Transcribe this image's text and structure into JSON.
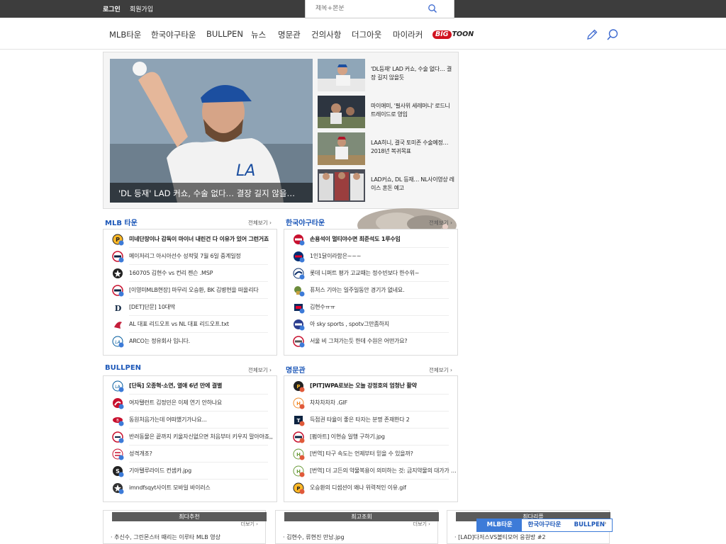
{
  "topbar": {
    "login": "로그인",
    "signup": "회원가입"
  },
  "search": {
    "placeholder": "제목+본문"
  },
  "nav": {
    "items": [
      "MLB타운",
      "한국야구타운",
      "BULLPEN",
      "뉴스",
      "명문관",
      "건의사항",
      "더그아웃",
      "마이라커"
    ],
    "bigtoon": {
      "big": "BIG",
      "toon": "TOON"
    }
  },
  "hero": {
    "caption": "'DL 등재' LAD 커쇼, 수술 없다… 결장 길지 않을…",
    "thumbs": [
      "'DL등재' LAD 커쇼, 수술 없다… 결장 길지 않을듯",
      "마이애미, '필사위 세레머니' 로드니 트레이드로 영입",
      "LAA히니, 결국 토미존 수술예정… 2018년 복귀목표",
      "LAD커쇼, DL 등재… NL사이영상 레이스 혼돈 예고"
    ]
  },
  "sections": {
    "mlb": {
      "title": "MLB 타운",
      "more": "전체보기 ›",
      "items": [
        "미네단장이나 감독이 마이너 내린건 다 이유가 있어 그런거죠",
        "메이저리그 아시아선수 성적및 7월 6일 중계일정",
        "160705 김현수 vs 컨리 젠슨 .MSP",
        "[이영미MLB현장] 마무리 오승환, BK 김병현을 떠올리다",
        "[DET]단문] 10대딱",
        "AL 대표 리드오프 vs NL 대표 리드오프.txt",
        "ARCO는 정유회사 입니다."
      ]
    },
    "korea": {
      "title": "한국야구타운",
      "more": "전체보기 ›",
      "items": [
        "손용석이 멀티야수면 최준석도 1루수임",
        "1인1닭이라함은~~~",
        "롯데 니퍼트 평가 고교때는 정수빈보다 한수위~",
        "퓨처스 기아는 일주일동안 경기가 없네요.",
        "김현수ㅠㅠ",
        "아 sky sports , spotv그만좀하지",
        "서울 비 그쳐가는듯 한데 수원은 어떤가요?"
      ]
    },
    "bullpen": {
      "title": "BULLPEN",
      "more": "전체보기 ›",
      "items": [
        "[단독] 오종혁·소연, 열애 6년 만에 결별",
        "여자탤런트 김정민은 이제 연기 안하나요",
        "동원처음가는데 어떠했기가나요...",
        "반려동물은 끝까지 키울자신없으면 처음부터 키우지 말아야죠,,",
        "성격개조?",
        "기아텔루라이드 컨셉카.jpg",
        "imndfsqyt사이트 모바일 바이러스"
      ]
    },
    "hall": {
      "title": "명문관",
      "more": "전체보기 ›",
      "items": [
        "[PIT]WPA로보는 오늘 강정호의 엄청난 활약",
        "차차차차차 .GIF",
        "득점권 타율이 좋은 타자는 분명 존재한다 2",
        "[펌아트] 이현승 일행 구하기.jpg",
        "[번역] 타구 속도는 언제부터 믿을 수 있을까?",
        "[번역] 더 고든의 약물복용이 의미하는 것: 금지약물의 대가가 …",
        "오승환의 디셉션이 왜나 위력적인 이유.gif"
      ]
    }
  },
  "bottom": {
    "recommend": {
      "title": "최다추천",
      "more": "더보기 ›",
      "item": "· 추신수, 그린몬스터 때리는 이루타 MLB 영상"
    },
    "views": {
      "title": "최고조회",
      "more": "더보기 ›",
      "item": "· 김현수, 류현진 만남.jpg"
    },
    "replies": {
      "title": "최다리플",
      "item": "· [LAD]다저스VS볼티모어 응원방 #2"
    },
    "tabs": [
      "MLB타운",
      "한국야구타운",
      "BULLPEN"
    ]
  },
  "colors": {
    "accent": "#1c57b8",
    "tab_active": "#3d7bd8",
    "topbar": "#3d3d3d",
    "bigtoon_red": "#d1121f"
  }
}
